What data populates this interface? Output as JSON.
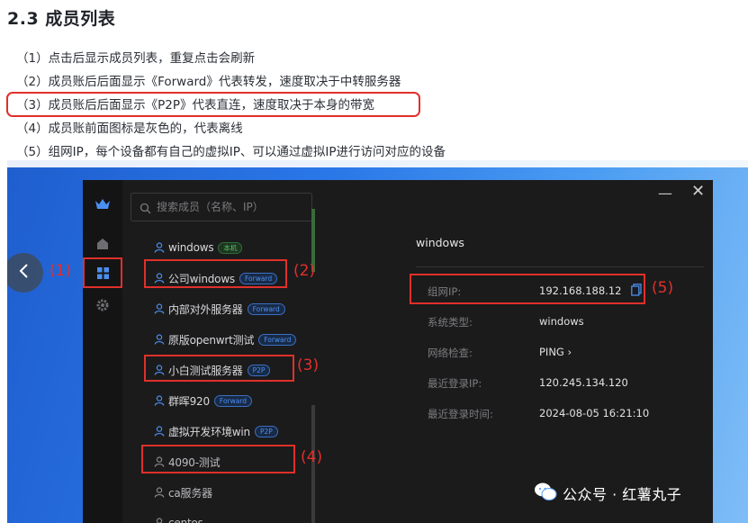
{
  "heading": "2.3 成员列表",
  "doc_lines": [
    "（1）点击后显示成员列表，重复点击会刷新",
    "（2）成员账后后面显示《Forward》代表转发，速度取决于中转服务器",
    "（3）成员账后后面显示《P2P》代表直连，速度取决于本身的带宽",
    "（4）成员账前面图标是灰色的，代表离线",
    "（5）组网IP，每个设备都有自己的虚拟IP、可以通过虚拟IP进行访问对应的设备"
  ],
  "app": {
    "search_placeholder": "搜索成员（名称、IP）",
    "rail_icons": [
      "crown-icon",
      "home-icon",
      "grid-icon",
      "gear-icon"
    ],
    "members": [
      {
        "name": "windows",
        "tag": "本机",
        "tag_type": "local",
        "online": true
      },
      {
        "name": "公司windows",
        "tag": "Forward",
        "tag_type": "forward",
        "online": true
      },
      {
        "name": "内部对外服务器",
        "tag": "Forward",
        "tag_type": "forward",
        "online": true
      },
      {
        "name": "原版openwrt测试",
        "tag": "Forward",
        "tag_type": "forward",
        "online": true
      },
      {
        "name": "小白测试服务器",
        "tag": "P2P",
        "tag_type": "p2p",
        "online": true
      },
      {
        "name": "群晖920",
        "tag": "Forward",
        "tag_type": "forward",
        "online": true
      },
      {
        "name": "虚拟开发环境win",
        "tag": "P2P",
        "tag_type": "p2p",
        "online": true
      },
      {
        "name": "4090-测试",
        "tag": "",
        "tag_type": "",
        "online": false
      },
      {
        "name": "ca服务器",
        "tag": "",
        "tag_type": "",
        "online": false
      },
      {
        "name": "centos",
        "tag": "",
        "tag_type": "",
        "online": false
      }
    ],
    "detail": {
      "title": "windows",
      "rows": [
        {
          "label": "组网IP:",
          "value": "192.168.188.12"
        },
        {
          "label": "系统类型:",
          "value": "windows"
        },
        {
          "label": "网络检查:",
          "value": "PING"
        },
        {
          "label": "最近登录IP:",
          "value": "120.245.134.120"
        },
        {
          "label": "最近登录时间:",
          "value": "2024-08-05 16:21:10"
        }
      ]
    }
  },
  "callouts": [
    "(1)",
    "(2)",
    "(3)",
    "(4)",
    "(5)"
  ],
  "watermark": "公众号 · 红薯丸子",
  "colors": {
    "highlight": "#e0302a",
    "accent": "#4b8ff0",
    "app_bg": "#1b1b1c"
  }
}
